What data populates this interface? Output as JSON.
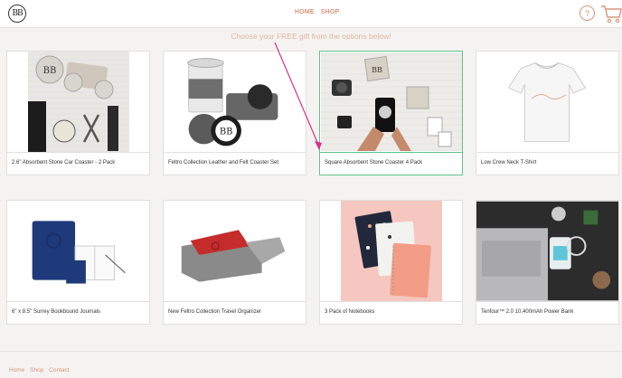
{
  "header": {
    "logo_text": "BB",
    "nav": [
      "HOME",
      "SHOP"
    ],
    "help_label": "?"
  },
  "subtitle": "Choose your FREE gift from the options below!",
  "products": [
    {
      "name": "2.6\" Absorbent Stone Car Coaster - 2 Pack"
    },
    {
      "name": "Feltro Collection Leather and Felt Coaster Set"
    },
    {
      "name": "Square Absorbent Stone Coaster 4 Pack",
      "selected": true
    },
    {
      "name": "Low Crew Neck T-Shirt"
    },
    {
      "name": "6\" x 8.5\" Surrey Bookbound Journals"
    },
    {
      "name": "New Feltro Collection Travel Organizer"
    },
    {
      "name": "3 Pack of Notebooks"
    },
    {
      "name": "Tenfour™ 2.0 10,400mAh Power Bank"
    }
  ],
  "footer": {
    "links": [
      "Home",
      "Shop",
      "Contact"
    ]
  },
  "colors": {
    "accent": "#d9957a",
    "selected_border": "#5fc38c",
    "annotation_arrow": "#d6338a"
  }
}
